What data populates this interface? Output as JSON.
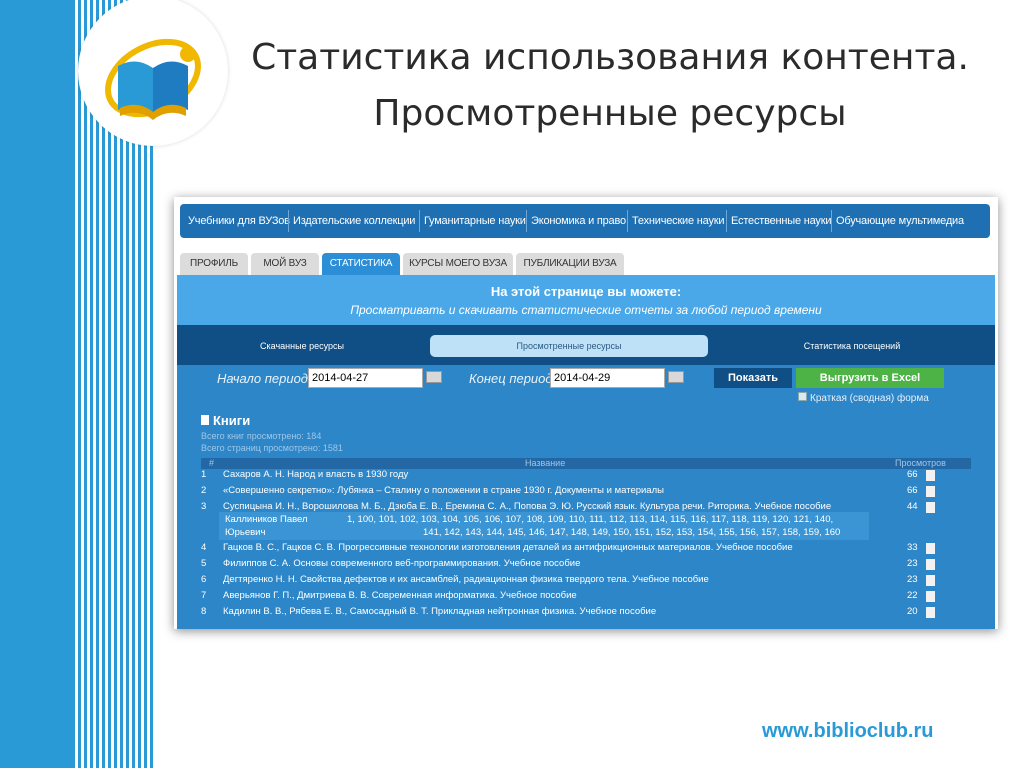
{
  "slide": {
    "title_line1": "Статистика использования контента.",
    "title_line2": "Просмотренные ресурсы",
    "url": "www.biblioclub.ru"
  },
  "nav": {
    "items": [
      "Учебники для ВУЗов",
      "Издательские коллекции",
      "Гуманитарные науки",
      "Экономика и право",
      "Технические науки",
      "Естественные науки",
      "Обучающие мультимедиа"
    ]
  },
  "tabs": [
    "ПРОФИЛЬ",
    "МОЙ ВУЗ",
    "СТАТИСТИКА",
    "КУРСЫ МОЕГО ВУЗА",
    "ПУБЛИКАЦИИ ВУЗА"
  ],
  "band": {
    "title": "На этой странице вы можете:",
    "subtitle": "Просматривать и скачивать статистические отчеты за любой период времени"
  },
  "subtabs": [
    "Скачанные ресурсы",
    "Просмотренные ресурсы",
    "Статистика посещений"
  ],
  "period": {
    "start_label": "Начало периода:",
    "start_value": "2014-04-27",
    "end_label": "Конец периода:",
    "end_value": "2014-04-29",
    "show_button": "Показать",
    "excel_button": "Выгрузить в Excel",
    "checkbox_label": "Краткая (сводная) форма"
  },
  "books": {
    "title": "Книги",
    "total_books": "Всего книг просмотрено: 184",
    "total_pages": "Всего страниц просмотрено: 1581",
    "col_num": "#",
    "col_name": "Название",
    "col_views": "Просмотров",
    "rows": [
      {
        "num": "1",
        "name": "Сахаров А. Н. Народ и власть в 1930 году",
        "views": "66"
      },
      {
        "num": "2",
        "name": "«Совершенно секретно»: Лубянка – Сталину о положении в стране 1930 г. Документы и материалы",
        "views": "66"
      },
      {
        "num": "3",
        "name": "Суспицына И. Н., Ворошилова М. Б., Дзюба Е. В., Еремина С. А., Попова Э. Ю. Русский язык. Культура речи. Риторика. Учебное пособие",
        "views": "44"
      },
      {
        "num": "4",
        "name": "Гацков В. С., Гацков С. В. Прогрессивные технологии изготовления деталей из антифрикционных материалов. Учебное пособие",
        "views": "33"
      },
      {
        "num": "5",
        "name": "Филиппов С. А. Основы современного веб-программирования. Учебное пособие",
        "views": "23"
      },
      {
        "num": "6",
        "name": "Дегтяренко Н. Н. Свойства дефектов и их ансамблей, радиационная физика твердого тела. Учебное пособие",
        "views": "23"
      },
      {
        "num": "7",
        "name": "Аверьянов Г. П., Дмитриева В. В. Современная информатика. Учебное пособие",
        "views": "22"
      },
      {
        "num": "8",
        "name": "Кадилин В. В., Рябева Е. В., Самосадный В. Т. Прикладная нейтронная физика. Учебное пособие",
        "views": "20"
      }
    ],
    "detail": {
      "user_line1": "Каллиников Павел",
      "user_line2": "Юрьевич",
      "pages_line1": "1, 100, 101, 102, 103, 104, 105, 106, 107, 108, 109, 110, 111, 112, 113, 114, 115, 116, 117, 118, 119, 120, 121, 140,",
      "pages_line2": "141, 142, 143, 144, 145, 146, 147, 148, 149, 150, 151, 152, 153, 154, 155, 156, 157, 158, 159, 160"
    }
  }
}
